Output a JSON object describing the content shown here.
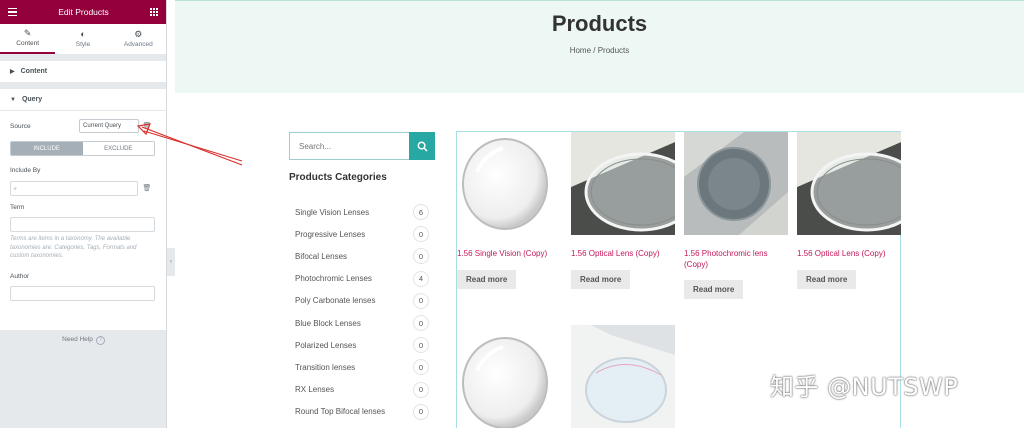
{
  "panel": {
    "title": "Edit Products",
    "tabs": [
      {
        "label": "Content",
        "icon": "pencil-icon"
      },
      {
        "label": "Style",
        "icon": "contrast-icon"
      },
      {
        "label": "Advanced",
        "icon": "gear-icon"
      }
    ],
    "sections": {
      "content": "Content",
      "query": "Query"
    },
    "query": {
      "source_label": "Source",
      "source_value": "Current Query",
      "include_label": "INCLUDE",
      "exclude_label": "EXCLUDE",
      "include_by_label": "Include By",
      "term_label": "Term",
      "help_text": "Terms are items in a taxonomy. The available taxonomies are: Categories, Tags, Formats and custom taxonomies.",
      "author_label": "Author"
    },
    "need_help": "Need Help",
    "accent_color": "#93003c"
  },
  "page": {
    "title": "Products",
    "breadcrumb": "Home / Products",
    "search_placeholder": "Search...",
    "categories_title": "Products Categories",
    "categories": [
      {
        "name": "Single Vision Lenses",
        "count": "6"
      },
      {
        "name": "Progressive Lenses",
        "count": "0"
      },
      {
        "name": "Bifocal Lenses",
        "count": "0"
      },
      {
        "name": "Photochromic Lenses",
        "count": "4"
      },
      {
        "name": "Poly Carbonate lenses",
        "count": "0"
      },
      {
        "name": "Blue Block Lenses",
        "count": "0"
      },
      {
        "name": "Polarized Lenses",
        "count": "0"
      },
      {
        "name": "Transition lenses",
        "count": "0"
      },
      {
        "name": "RX Lenses",
        "count": "0"
      },
      {
        "name": "Round Top Bifocal lenses",
        "count": "0"
      }
    ],
    "products": [
      {
        "name": "1.56 Single Vision (Copy)",
        "button": "Read more"
      },
      {
        "name": "1.56 Optical Lens (Copy)",
        "button": "Read more"
      },
      {
        "name": "1.56 Photochromic lens (Copy)",
        "button": "Read more"
      },
      {
        "name": "1.56 Optical Lens (Copy)",
        "button": "Read more"
      }
    ],
    "accent_color": "#27a8a3",
    "product_link_color": "#c2185b"
  },
  "watermark": "知乎 @NUTSWP"
}
